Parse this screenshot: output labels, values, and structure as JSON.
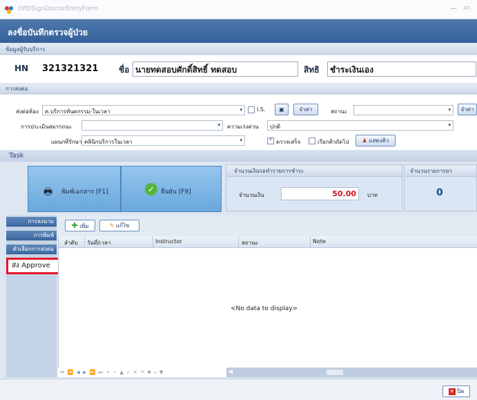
{
  "window": {
    "title": "OPDSignDoctorEntryForm",
    "min_glyph": "—",
    "max_glyph": "▭"
  },
  "header": {
    "title": "ลงชื่อบันทึกตรวจผู้ป่วย"
  },
  "sections": {
    "patient_info": "ข้อมูลผู้รับบริการ",
    "referral": "การส่งต่อ"
  },
  "patient": {
    "hn_label": "HN",
    "hn_value": "321321321",
    "name_label": "ชื่อ",
    "name_value": "นายทดสอบศักดิ์สิทธิ์ ทดสอบ",
    "right_label": "สิทธิ",
    "right_value": "ชำระเงินเอง"
  },
  "referral": {
    "to_room_label": "ส่งต่อห้อง",
    "to_room_value": "ค.บริการทันตกรรม-ในเวลา",
    "is_label": "I.S.",
    "remember_button": "จำค่า",
    "status_label": "สถานะ",
    "status_value": "",
    "remember_button_2": "จำค่า",
    "assessment_label": "การประเมินสมรรถนะ",
    "assessment_value": "",
    "urgency_label": "ความเร่งด่วน",
    "urgency_value": "ปกติ",
    "dept_label": "แผนกที่รักษา",
    "dept_value": "คลินิกบริการในเวลา",
    "check_done_label": "ตรวจเสร็จ",
    "check_done_checked": true,
    "call_next_label": "เรียกคิวถัดไป",
    "call_next_checked": false,
    "show_queue_button": "แสดงคิว"
  },
  "task": {
    "label": "Task",
    "print_button": "พิมพ์เอกสาร [F1]",
    "confirm_button": "ยืนยัน [F9]",
    "payment_group_title": "จำนวนเงินรอทำรายการชำระ",
    "amount_label": "จำนวนเงิน",
    "amount_value": "50.00",
    "amount_unit": "บาท",
    "drug_group_title": "จำนวนรายการยา",
    "drug_count": "0"
  },
  "left_tabs": [
    "การลงนาม",
    "การพิมพ์",
    "ตัวเลือกการส่งต่อ"
  ],
  "approve_tab": "ส่ง Approve",
  "grid": {
    "add_button": "เพิ่ม",
    "edit_button": "แก้ไข",
    "columns": [
      "ลำดับ",
      "วันที่/เวลา",
      "Instructor",
      "สถานะ",
      "Note"
    ],
    "empty_text": "<No data to display>",
    "navigator": "⏮ ⏪ ◀ ▶ ⏩ ⏭ + − ▲ ✓ ✕ ↷ ✱ ⁎ ▼"
  },
  "footer": {
    "close_button": "ปิด"
  },
  "colors": {
    "accent": "#34609a",
    "amount": "#d0141e",
    "approve_border": "#e8132a"
  }
}
